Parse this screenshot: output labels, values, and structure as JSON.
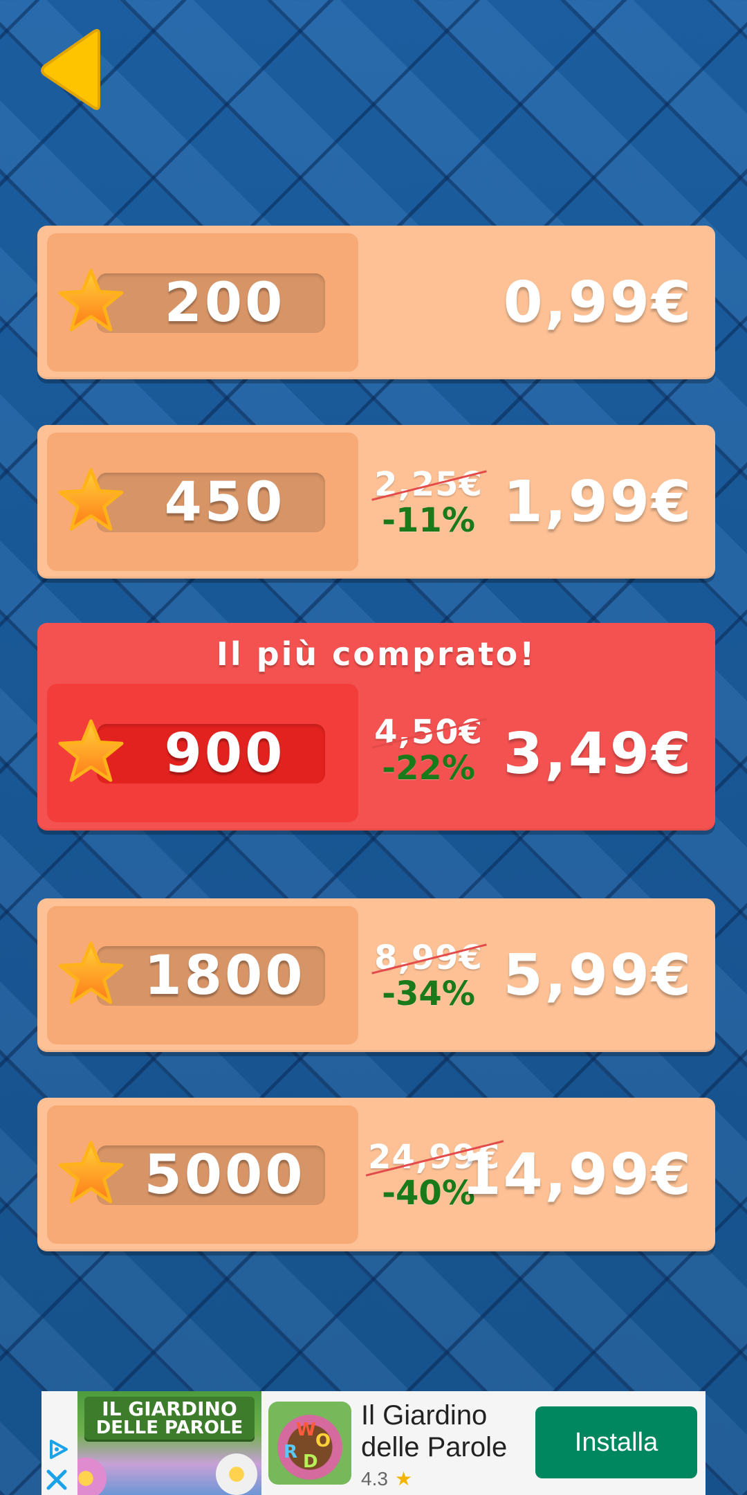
{
  "navigation": {
    "back_icon": "back-arrow-icon",
    "accent_color": "#ffc400"
  },
  "offers": [
    {
      "amount": "200",
      "price": "0,99€",
      "old_price": "",
      "discount": ""
    },
    {
      "amount": "450",
      "price": "1,99€",
      "old_price": "2,25€",
      "discount": "-11%"
    },
    {
      "amount": "900",
      "price": "3,49€",
      "old_price": "4,50€",
      "discount": "-22%",
      "badge": "Il più comprato!"
    },
    {
      "amount": "1800",
      "price": "5,99€",
      "old_price": "8,99€",
      "discount": "-34%"
    },
    {
      "amount": "5000",
      "price": "14,99€",
      "old_price": "24,99€",
      "discount": "-40%"
    }
  ],
  "colors": {
    "offer_bg": "#fdc195",
    "featured_bg": "#f45250",
    "discount_text": "#1a7a1a",
    "background": "#1a5c9c"
  },
  "ad": {
    "image_title_line1": "IL GIARDINO",
    "image_title_line2": "DELLE PAROLE",
    "title": "Il Giardino delle Parole",
    "rating": "4.3",
    "install_label": "Installa",
    "install_color": "#01875f"
  }
}
